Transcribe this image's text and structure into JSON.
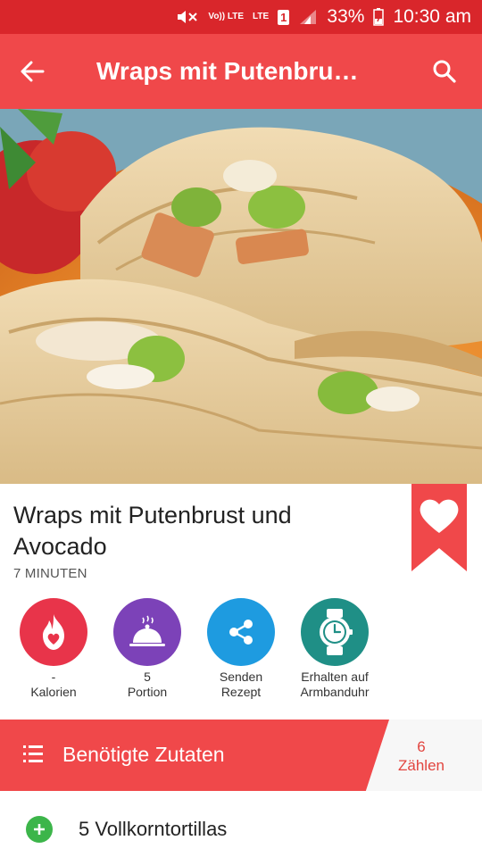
{
  "status_bar": {
    "volte": "Vo)) LTE",
    "lte": "LTE",
    "sim": "1",
    "battery": "33%",
    "time": "10:30 am"
  },
  "app_bar": {
    "title": "Wraps mit Putenbrust…",
    "back_icon": "arrow-back-icon",
    "search_icon": "search-icon"
  },
  "recipe": {
    "title": "Wraps mit Putenbrust und Avocado",
    "duration": "7 MINUTEN",
    "favorite_icon": "heart-icon"
  },
  "actions": [
    {
      "name": "calories",
      "line1": "-",
      "line2": "Kalorien",
      "color": "#e8344a",
      "icon": "flame-heart-icon"
    },
    {
      "name": "portion",
      "line1": "5",
      "line2": "Portion",
      "color": "#7c42b8",
      "icon": "cloche-icon"
    },
    {
      "name": "share",
      "line1": "Senden",
      "line2": "Rezept",
      "color": "#1e9be0",
      "icon": "share-icon"
    },
    {
      "name": "watch",
      "line1": "Erhalten auf",
      "line2": "Armbanduhr",
      "color": "#1f8f86",
      "icon": "watch-icon"
    }
  ],
  "ingredients_section": {
    "label": "Benötigte Zutaten",
    "count": "6",
    "count_label": "Zählen",
    "accent": "#f0484a"
  },
  "ingredients": [
    {
      "text": "5 Vollkorntortillas"
    }
  ]
}
